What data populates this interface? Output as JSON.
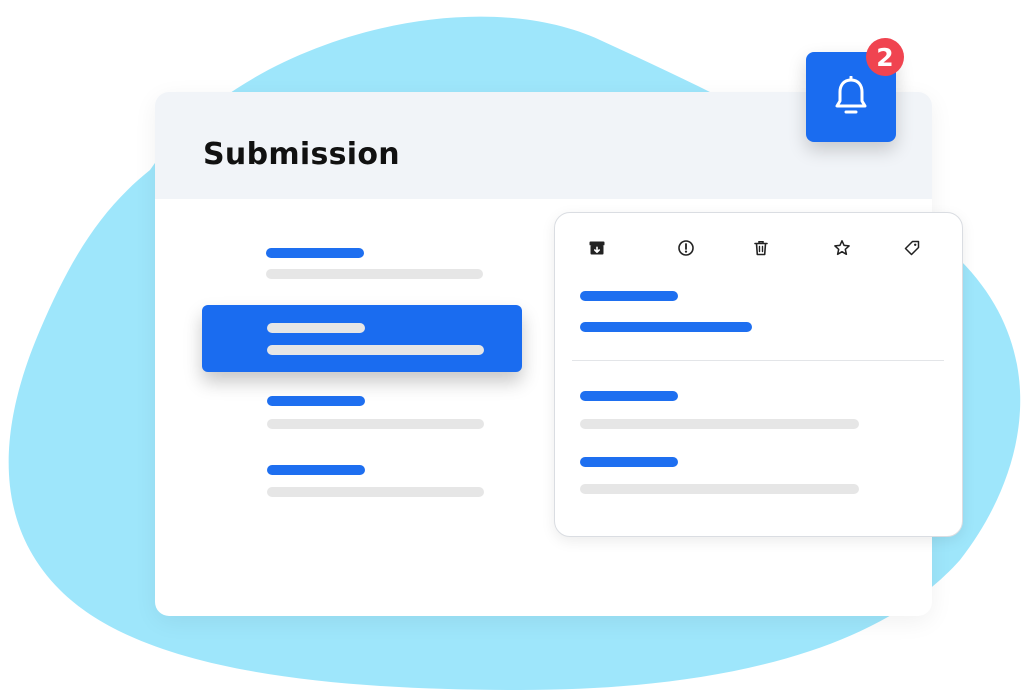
{
  "window": {
    "title": "Submission"
  },
  "notifications": {
    "count": "2",
    "icon": "bell-icon"
  },
  "toolbar": {
    "icons": [
      "archive-icon",
      "report-icon",
      "delete-icon",
      "star-icon",
      "tag-icon"
    ]
  },
  "list": {
    "items": 4,
    "selected_index": 1
  },
  "colors": {
    "accent": "#1a6cf0",
    "badge": "#f04450",
    "blob": "#9ee6fb",
    "header": "#f1f4f8",
    "placeholder": "#e6e6e6"
  }
}
